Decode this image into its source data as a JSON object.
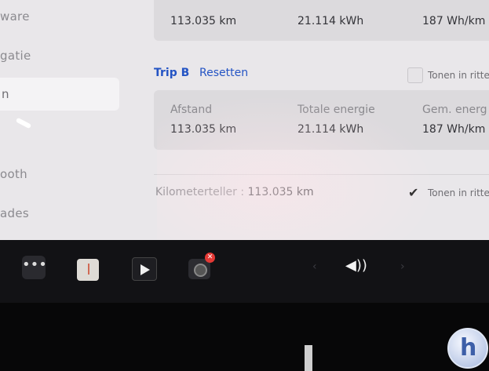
{
  "sidebar": {
    "items": [
      {
        "label": "ware"
      },
      {
        "label": "gatie"
      },
      {
        "label": "n"
      },
      {
        "label": "ooth"
      },
      {
        "label": "ades"
      }
    ]
  },
  "trip_a": {
    "distance_value": "113.035 km",
    "energy_value": "21.114 kWh",
    "avg_value": "187 Wh/km"
  },
  "trip_b": {
    "title": "Trip B",
    "reset_label": "Resetten",
    "toggle_label": "Tonen in ritte",
    "distance_label": "Afstand",
    "energy_label": "Totale energie",
    "avg_label": "Gem. energ",
    "distance_value": "113.035 km",
    "energy_value": "21.114 kWh",
    "avg_value": "187 Wh/km"
  },
  "odometer": {
    "label": "Kilometerteller",
    "value": "113.035 km",
    "toggle_label": "Tonen in ritte",
    "toggle_checked": true
  },
  "taskbar": {
    "dots_label": "•••",
    "camera_badge": "✕",
    "prev_chevron": "‹",
    "next_chevron": "›",
    "volume_glyph": "◀))"
  },
  "icons": [
    "menu-dots-icon",
    "app-tile-icon",
    "media-player-icon",
    "camera-icon",
    "volume-icon"
  ],
  "colors": {
    "link_blue": "#2454c4",
    "badge_red": "#e53935"
  }
}
